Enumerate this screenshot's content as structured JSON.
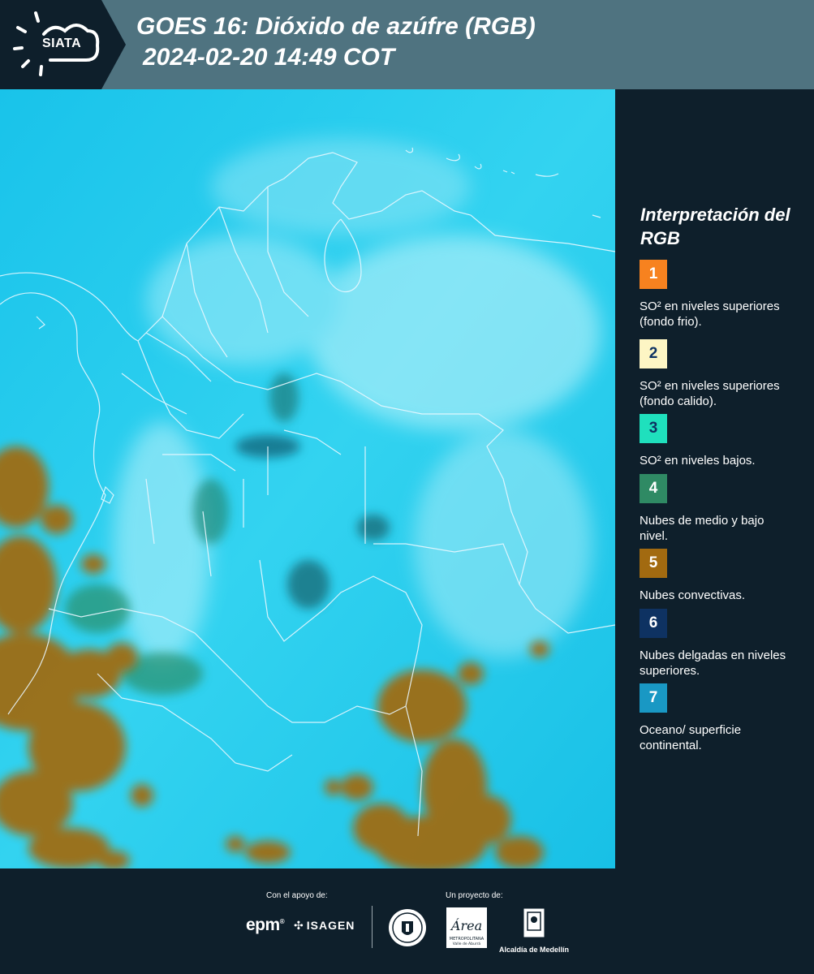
{
  "header": {
    "logo_text": "SIATA",
    "title_line1": "GOES 16: Dióxido de azúfre (RGB)",
    "title_line2": "2024-02-20 14:49 COT"
  },
  "legend": {
    "title": "Interpretación del RGB",
    "items": [
      {
        "number": "1",
        "label": "SO² en niveles superiores (fondo frio).",
        "color": "#f7821f"
      },
      {
        "number": "2",
        "label": "SO² en niveles superiores (fondo calido).",
        "color": "#fdf5c4"
      },
      {
        "number": "3",
        "label": "SO² en niveles bajos.",
        "color": "#1fe0bd"
      },
      {
        "number": "4",
        "label": "Nubes de medio y bajo nivel.",
        "color": "#2f8a64"
      },
      {
        "number": "5",
        "label": "Nubes convectivas.",
        "color": "#a26a10"
      },
      {
        "number": "6",
        "label": "Nubes delgadas en niveles superiores.",
        "color": "#0e3262"
      },
      {
        "number": "7",
        "label": "Oceano/ superficie continental.",
        "color": "#1998c4"
      }
    ]
  },
  "footer": {
    "support_label": "Con el apoyo de:",
    "project_label": "Un proyecto de:",
    "epm": "epm",
    "isagen": "ISAGEN",
    "area_label": "Área",
    "area_sub": "METROPOLITANA",
    "area_sub2": "Valle de Aburrá",
    "alcaldia": "Alcaldía de Medellín"
  },
  "colors": {
    "background": "#0e1f2b",
    "header": "#4f7380",
    "map_base": "#17c6e8",
    "convective": "#a26a10"
  }
}
